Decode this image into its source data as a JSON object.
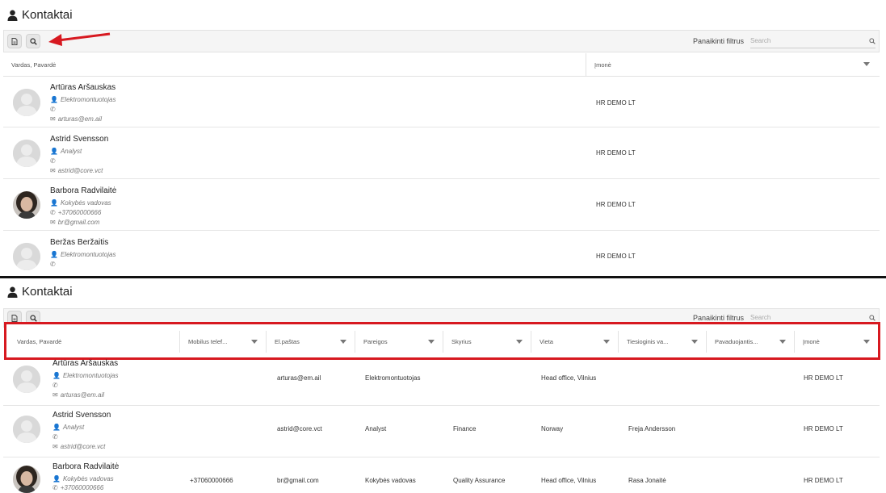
{
  "top": {
    "title": "Kontaktai",
    "toolbar": {
      "clear_filters": "Panaikinti filtrus",
      "search_placeholder": "Search"
    },
    "columns": [
      "Vardas, Pavardė",
      "Įmonė"
    ],
    "rows": [
      {
        "name": "Artūras Aršauskas",
        "position": "Elektromontuotojas",
        "phone": "",
        "email": "arturas@em.ail",
        "company": "HR DEMO LT",
        "avatar": "placeholder"
      },
      {
        "name": "Astrid Svensson",
        "position": "Analyst",
        "phone": "",
        "email": "astrid@core.vct",
        "company": "HR DEMO LT",
        "avatar": "placeholder"
      },
      {
        "name": "Barbora Radvilaitė",
        "position": "Kokybės vadovas",
        "phone": "+37060000666",
        "email": "br@gmail.com",
        "company": "HR DEMO LT",
        "avatar": "photo"
      },
      {
        "name": "Beržas Beržaitis",
        "position": "Elektromontuotojas",
        "phone": "",
        "email": "",
        "company": "HR DEMO LT",
        "avatar": "placeholder"
      }
    ]
  },
  "bottom": {
    "title": "Kontaktai",
    "toolbar": {
      "clear_filters": "Panaikinti filtrus",
      "search_placeholder": "Search"
    },
    "columns": [
      "Vardas, Pavardė",
      "Mobilus telef...",
      "El.paštas",
      "Pareigos",
      "Skyrius",
      "Vieta",
      "Tiesioginis va...",
      "Pavaduojantis...",
      "Įmonė"
    ],
    "rows": [
      {
        "name": "Artūras Aršauskas",
        "position": "Elektromontuotojas",
        "phone": "",
        "email": "arturas@em.ail",
        "mobile": "",
        "email_col": "arturas@em.ail",
        "role": "Elektromontuotojas",
        "department": "",
        "location": "Head office, Vilnius",
        "manager": "",
        "deputy": "",
        "company": "HR DEMO LT",
        "avatar": "placeholder"
      },
      {
        "name": "Astrid Svensson",
        "position": "Analyst",
        "phone": "",
        "email": "astrid@core.vct",
        "mobile": "",
        "email_col": "astrid@core.vct",
        "role": "Analyst",
        "department": "Finance",
        "location": "Norway",
        "manager": "Freja Andersson",
        "deputy": "",
        "company": "HR DEMO LT",
        "avatar": "placeholder"
      },
      {
        "name": "Barbora Radvilaitė",
        "position": "Kokybės vadovas",
        "phone": "+37060000666",
        "email": "",
        "mobile": "+37060000666",
        "email_col": "br@gmail.com",
        "role": "Kokybės vadovas",
        "department": "Quality Assurance",
        "location": "Head office, Vilnius",
        "manager": "Rasa Jonaitė",
        "deputy": "",
        "company": "HR DEMO LT",
        "avatar": "photo"
      }
    ]
  },
  "annotations": {
    "arrow_color": "#d71920",
    "highlight_color": "#d71920"
  }
}
